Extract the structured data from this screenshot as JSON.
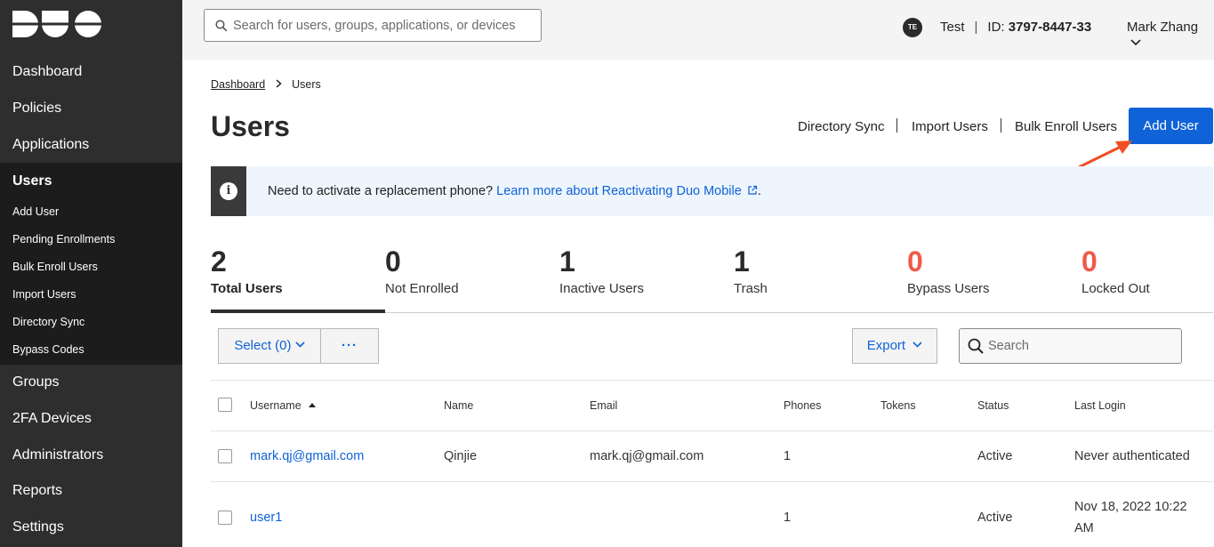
{
  "sidebar": {
    "items": [
      {
        "label": "Dashboard"
      },
      {
        "label": "Policies"
      },
      {
        "label": "Applications"
      },
      {
        "label": "Users"
      },
      {
        "label": "Groups"
      },
      {
        "label": "2FA Devices"
      },
      {
        "label": "Administrators"
      },
      {
        "label": "Reports"
      },
      {
        "label": "Settings"
      }
    ],
    "subitems": [
      {
        "label": "Add User"
      },
      {
        "label": "Pending Enrollments"
      },
      {
        "label": "Bulk Enroll Users"
      },
      {
        "label": "Import Users"
      },
      {
        "label": "Directory Sync"
      },
      {
        "label": "Bypass Codes"
      }
    ]
  },
  "topbar": {
    "search_placeholder": "Search for users, groups, applications, or devices",
    "account_badge": "TE",
    "account_name": "Test",
    "id_label": "ID:",
    "id_value": "3797-8447-33",
    "user_name": "Mark Zhang"
  },
  "breadcrumb": {
    "parent": "Dashboard",
    "current": "Users"
  },
  "page": {
    "title": "Users",
    "actions": {
      "directory_sync": "Directory Sync",
      "import_users": "Import Users",
      "bulk_enroll": "Bulk Enroll Users",
      "add_user": "Add User"
    }
  },
  "banner": {
    "text": "Need to activate a replacement phone?",
    "link": "Learn more about Reactivating Duo Mobile",
    "trailing": "."
  },
  "stats": [
    {
      "value": "2",
      "label": "Total Users"
    },
    {
      "value": "0",
      "label": "Not Enrolled"
    },
    {
      "value": "1",
      "label": "Inactive Users"
    },
    {
      "value": "1",
      "label": "Trash"
    },
    {
      "value": "0",
      "label": "Bypass Users"
    },
    {
      "value": "0",
      "label": "Locked Out"
    }
  ],
  "toolbar": {
    "select_label": "Select (0)",
    "more_label": "···",
    "export_label": "Export",
    "search_placeholder": "Search"
  },
  "table": {
    "headers": [
      "Username",
      "Name",
      "Email",
      "Phones",
      "Tokens",
      "Status",
      "Last Login"
    ],
    "rows": [
      {
        "username": "mark.qj@gmail.com",
        "name": "Qinjie",
        "email": "mark.qj@gmail.com",
        "phones": "1",
        "tokens": "",
        "status": "Active",
        "last_login_1": "Never authenticated",
        "last_login_2": ""
      },
      {
        "username": "user1",
        "name": "",
        "email": "",
        "phones": "1",
        "tokens": "",
        "status": "Active",
        "last_login_1": "Nov 18, 2022 10:22",
        "last_login_2": "AM"
      }
    ]
  },
  "colors": {
    "sidebar_bg": "#2e2e2e",
    "primary": "#0f62d7",
    "alert_red": "#f05a48",
    "arrow": "#f04e23"
  }
}
